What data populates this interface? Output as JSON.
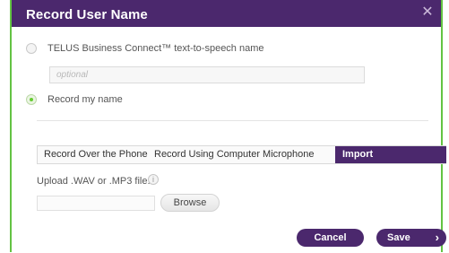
{
  "dialog": {
    "title": "Record User Name",
    "close_glyph": "✕"
  },
  "options": {
    "tts_label": "TELUS Business Connect™ text-to-speech name",
    "optional_placeholder": "optional",
    "record_label": "Record my name",
    "selected": "record"
  },
  "tabs": [
    {
      "label": "Record Over the Phone",
      "active": false
    },
    {
      "label": "Record Using Computer Microphone",
      "active": false
    },
    {
      "label": "Import",
      "active": true
    }
  ],
  "upload": {
    "label": "Upload .WAV or .MP3 file:",
    "info_glyph": "i",
    "browse_label": "Browse"
  },
  "footer": {
    "cancel_label": "Cancel",
    "save_label": "Save",
    "save_chevron": "›"
  },
  "colors": {
    "brand": "#4b286d",
    "accent": "#66cc33"
  }
}
